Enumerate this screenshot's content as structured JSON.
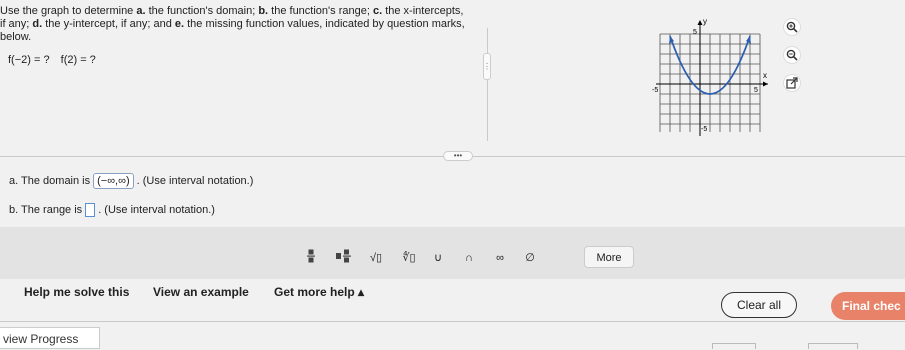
{
  "question": {
    "line1_pre": "Use the graph to determine ",
    "a_letter": "a.",
    "a_text": " the function's domain; ",
    "b_letter": "b.",
    "b_text": " the function's range; ",
    "c_letter": "c.",
    "c_text": " the x-intercepts,",
    "line2_pre": "if any; ",
    "d_letter": "d.",
    "d_text": " the y-intercept, if any; and ",
    "e_letter": "e.",
    "e_text": " the missing function values, indicated by question marks,",
    "line3": "below."
  },
  "function_values": {
    "f_neg2": "f(−2) = ?",
    "f_2": "f(2) = ?"
  },
  "graph": {
    "y_label": "y",
    "x_label": "x",
    "top_tick": "5",
    "left_tick": "-5",
    "right_tick": "5",
    "bottom_tick": "-5",
    "curve_color": "#2d5fb0"
  },
  "answers": {
    "a_prefix": "a. The domain is",
    "a_value": "(−∞,∞)",
    "a_suffix": ". (Use interval notation.)",
    "b_prefix": "b. The range is",
    "b_suffix": ". (Use interval notation.)"
  },
  "toolbar": {
    "fraction_icon": "fraction-icon",
    "mixed_number_icon": "mixed-number-icon",
    "sqrt": "√▯",
    "nthroot": "∜▯",
    "union": "∪",
    "intersection": "∩",
    "infinity": "∞",
    "empty_set": "∅",
    "more_label": "More"
  },
  "actions": {
    "help_solve": "Help me solve this",
    "view_example": "View an example",
    "get_more_help": "Get more help ▴",
    "clear_all": "Clear all",
    "final_check": "Final chec"
  },
  "footer": {
    "view_progress": "view Progress"
  },
  "colors": {
    "accent_orange": "#e8836a",
    "input_border": "#5a8fd6"
  }
}
